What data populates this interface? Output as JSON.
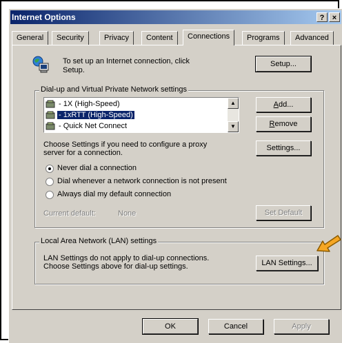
{
  "window": {
    "title": "Internet Options",
    "help_label": "?",
    "close_label": "×"
  },
  "tabs": [
    "General",
    "Security",
    "Privacy",
    "Content",
    "Connections",
    "Programs",
    "Advanced"
  ],
  "setup": {
    "text_line1": "To set up an Internet connection, click",
    "text_line2": "Setup.",
    "button": "Setup..."
  },
  "dialup": {
    "group_label": "Dial-up and Virtual Private Network settings",
    "connections": [
      "- 1X (High-Speed)",
      "- 1xRTT (High-Speed)",
      "- Quick Net Connect"
    ],
    "selected_index": 1,
    "add_button": "Add...",
    "remove_button": "Remove",
    "settings_text_line1": "Choose Settings if you need to configure a proxy",
    "settings_text_line2": "server for a connection.",
    "settings_button": "Settings...",
    "radio_never": "Never dial a connection",
    "radio_whenever": "Dial whenever a network connection is not present",
    "radio_always": "Always dial my default connection",
    "current_default_label": "Current default:",
    "current_default_value": "None",
    "set_default_button": "Set Default"
  },
  "lan": {
    "group_label": "Local Area Network (LAN) settings",
    "text_line1": "LAN Settings do not apply to dial-up connections.",
    "text_line2": "Choose Settings above for dial-up settings.",
    "button": "LAN Settings..."
  },
  "footer": {
    "ok": "OK",
    "cancel": "Cancel",
    "apply": "Apply"
  },
  "colors": {
    "arrow": "#f5a623",
    "titlebar": "#0a246a",
    "face": "#d4d0c8"
  }
}
